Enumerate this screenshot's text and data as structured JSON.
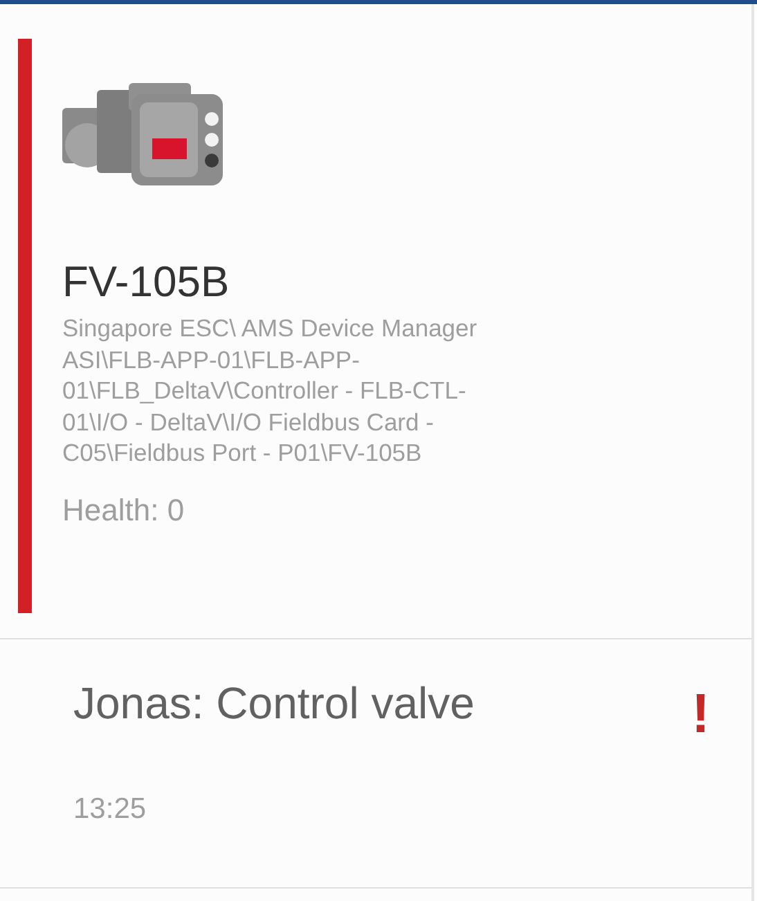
{
  "device": {
    "tag": "FV-105B",
    "path": "Singapore ESC\\ AMS Device Manager ASI\\FLB-APP-01\\FLB-APP-01\\FLB_DeltaV\\Controller - FLB-CTL-01\\I/O - DeltaV\\I/O Fieldbus Card - C05\\Fieldbus Port - P01\\FV-105B",
    "health": "Health: 0"
  },
  "message": {
    "title": "Jonas: Control valve",
    "alert": "!",
    "time": "13:25"
  }
}
